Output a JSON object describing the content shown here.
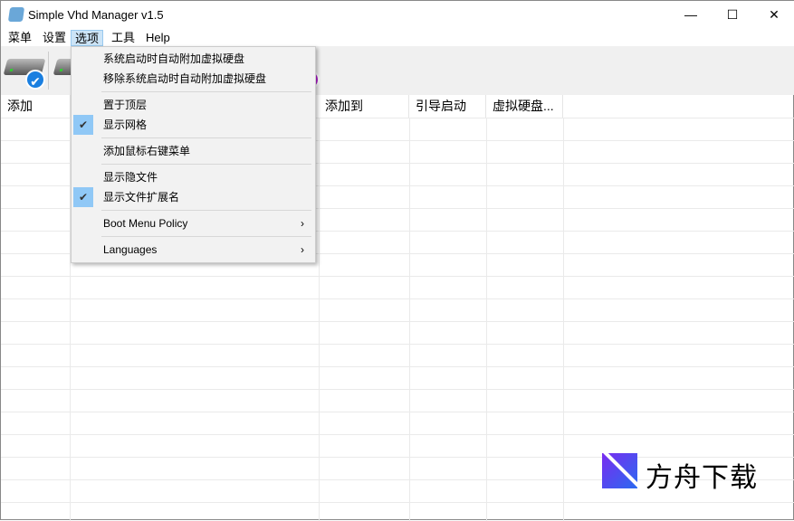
{
  "window": {
    "title": "Simple Vhd Manager v1.5",
    "minimize": "—",
    "maximize": "☐",
    "close": "✕"
  },
  "menubar": [
    "菜单",
    "设置",
    "选项",
    "工具",
    "Help"
  ],
  "toolbar": {
    "badge_glyph": "✔"
  },
  "columns": [
    "添加",
    "添加到",
    "引导启动",
    "虚拟硬盘..."
  ],
  "dropdown": {
    "items": [
      {
        "label": "系统启动时自动附加虚拟硬盘",
        "checked": false
      },
      {
        "label": "移除系统启动时自动附加虚拟硬盘",
        "checked": false
      },
      {
        "label": "置于顶层",
        "checked": false
      },
      {
        "label": "显示网格",
        "checked": true
      },
      {
        "label": "添加鼠标右键菜单",
        "checked": false
      },
      {
        "label": "显示隐文件",
        "checked": false
      },
      {
        "label": "显示文件扩展名",
        "checked": true
      },
      {
        "label": "Boot Menu Policy",
        "submenu": true
      },
      {
        "label": "Languages",
        "submenu": true
      }
    ],
    "check_glyph": "✔",
    "arrow_glyph": "›"
  },
  "watermark": {
    "text": "方舟下载"
  }
}
